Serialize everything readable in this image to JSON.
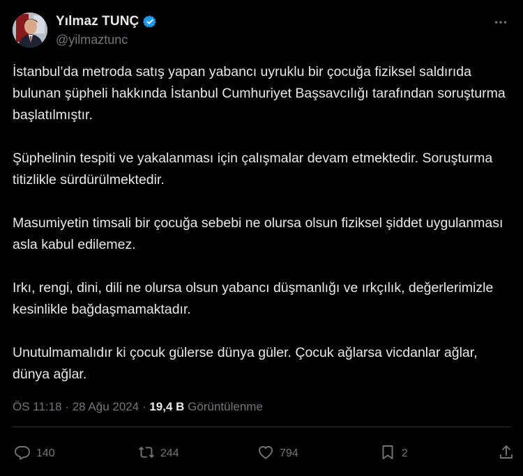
{
  "author": {
    "display_name": "Yılmaz TUNÇ",
    "handle": "@yilmaztunc",
    "avatar_icon": "profile-photo",
    "verified_icon": "verified-badge-icon",
    "verified_color": "#1d9bf0"
  },
  "menu": {
    "icon": "more-horizontal-icon"
  },
  "paragraphs": [
    "İstanbul’da metroda satış yapan yabancı uyruklu bir çocuğa fiziksel saldırıda bulunan şüpheli hakkında İstanbul Cumhuriyet Başsavcılığı tarafından soruşturma başlatılmıştır.",
    "Şüphelinin tespiti ve yakalanması için çalışmalar devam etmektedir. Soruşturma titizlikle sürdürülmektedir.",
    "Masumiyetin timsali bir çocuğa sebebi ne olursa olsun fiziksel şiddet uygulanması asla kabul edilemez.",
    "Irkı, rengi, dini, dili ne olursa olsun yabancı düşmanlığı ve ırkçılık, değerlerimizle kesinlikle bağdaşmamaktadır.",
    "Unutulmamalıdır ki çocuk gülerse dünya güler. Çocuk ağlarsa vicdanlar ağlar, dünya ağlar."
  ],
  "meta": {
    "time": "ÖS 11:18",
    "separator": "·",
    "date": "28 Ağu 2024",
    "views_count": "19,4 B",
    "views_label": "Görüntülenme"
  },
  "actions": {
    "reply": {
      "icon": "reply-icon",
      "count": "140"
    },
    "repost": {
      "icon": "repost-icon",
      "count": "244"
    },
    "like": {
      "icon": "like-icon",
      "count": "794"
    },
    "bookmark": {
      "icon": "bookmark-icon",
      "count": "2"
    },
    "share": {
      "icon": "share-icon"
    }
  },
  "colors": {
    "background": "#000000",
    "text": "#e7e9ea",
    "muted": "#71767b",
    "divider": "#2f3336"
  }
}
